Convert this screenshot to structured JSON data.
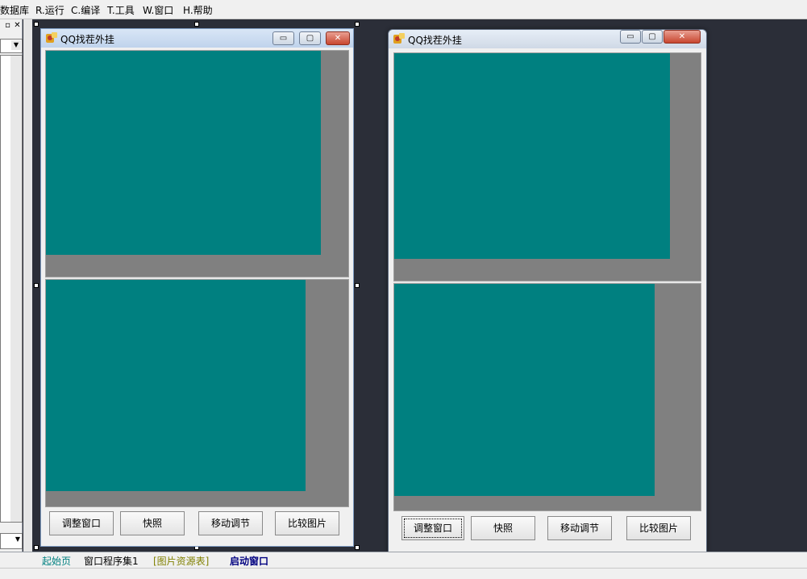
{
  "menu": [
    "数据库",
    "R.运行",
    "C.编译",
    "T.工具",
    "W.窗口",
    "H.帮助"
  ],
  "left_panel": {
    "restore_icon": "restore-icon",
    "close_icon": "close-icon",
    "dropdown_icon": "chevron-down-icon"
  },
  "design_window": {
    "title": "QQ找茬外挂",
    "minimize": "▭",
    "maximize": "▢",
    "close": "✕"
  },
  "preview_window": {
    "title": "QQ找茬外挂",
    "minimize": "▭",
    "maximize": "▢",
    "close": "✕"
  },
  "buttons": [
    "调整窗口",
    "快照",
    "移动调节",
    "比较图片"
  ],
  "tabs": [
    {
      "label": "起始页",
      "color": "#008080"
    },
    {
      "label": "窗口程序集1",
      "color": "#000000"
    },
    {
      "label": "[图片资源表]",
      "color": "#808000"
    },
    {
      "label": "启动窗口",
      "color": "#000080"
    }
  ],
  "colors": {
    "picture_fill": "#008080",
    "pane_bg": "#808080",
    "workspace_bg": "#2b2e38"
  }
}
